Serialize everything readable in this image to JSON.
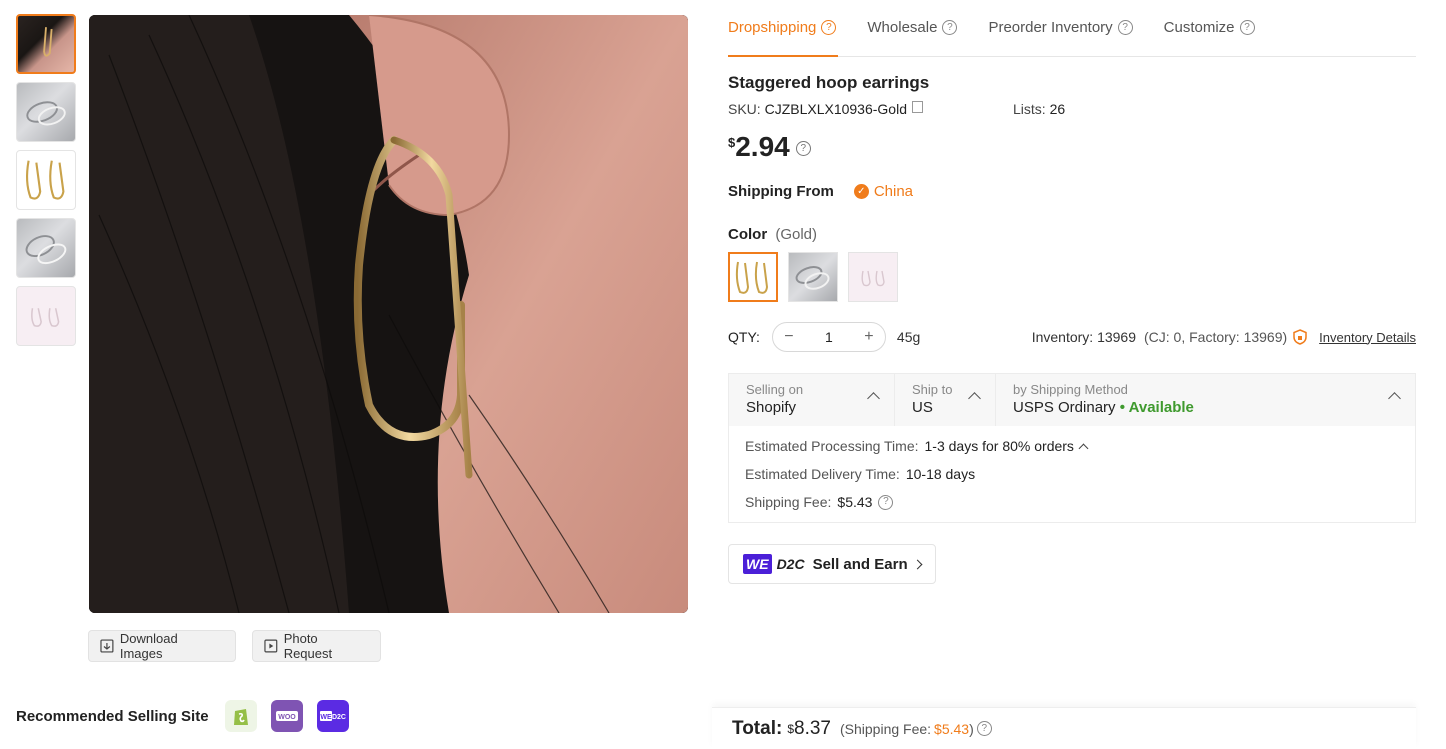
{
  "gallery": {
    "thumbnails": [
      "ear-model",
      "silver-pair",
      "gold-pair",
      "silver-pair-2",
      "pink-pair"
    ],
    "download_label": "Download Images",
    "photo_request_label": "Photo Request"
  },
  "recommended": {
    "label": "Recommended Selling Site",
    "sites": [
      "shopify",
      "woocommerce",
      "we-d2c"
    ]
  },
  "tabs": [
    {
      "label": "Dropshipping",
      "active": true
    },
    {
      "label": "Wholesale",
      "active": false
    },
    {
      "label": "Preorder Inventory",
      "active": false
    },
    {
      "label": "Customize",
      "active": false
    }
  ],
  "product": {
    "title": "Staggered hoop earrings",
    "sku_label": "SKU:",
    "sku": "CJZBLXLX10936-Gold",
    "lists_label": "Lists:",
    "lists": "26",
    "currency": "$",
    "price": "2.94"
  },
  "shipping_from": {
    "label": "Shipping From",
    "country": "China"
  },
  "color": {
    "label": "Color",
    "selected": "(Gold)",
    "options": [
      "gold",
      "silver",
      "pink"
    ]
  },
  "qty": {
    "label": "QTY:",
    "value": "1",
    "minus": "−",
    "plus": "+",
    "weight": "45g"
  },
  "inventory": {
    "text": "Inventory: 13969",
    "detail": "(CJ: 0, Factory: 13969)",
    "link": "Inventory Details"
  },
  "shipping": {
    "selling_on_caption": "Selling on",
    "selling_on": "Shopify",
    "ship_to_caption": "Ship to",
    "ship_to": "US",
    "method_caption": "by Shipping Method",
    "method": "USPS Ordinary",
    "availability": "• Available",
    "processing_label": "Estimated Processing Time:",
    "processing_value": "1-3 days for 80% orders",
    "delivery_label": "Estimated Delivery Time:",
    "delivery_value": "10-18 days",
    "fee_label": "Shipping Fee:",
    "fee_value": "$5.43"
  },
  "d2c": {
    "badge": "WE",
    "brand": "D2C",
    "label": "Sell and Earn"
  },
  "total": {
    "label": "Total:",
    "currency": "$",
    "value": "8.37",
    "ship_prefix": "(Shipping Fee:",
    "ship_fee": "$5.43",
    "ship_suffix": ")"
  },
  "colors": {
    "accent": "#f07c1b",
    "available": "#3f9a2e",
    "d2c": "#4b1fd8"
  }
}
